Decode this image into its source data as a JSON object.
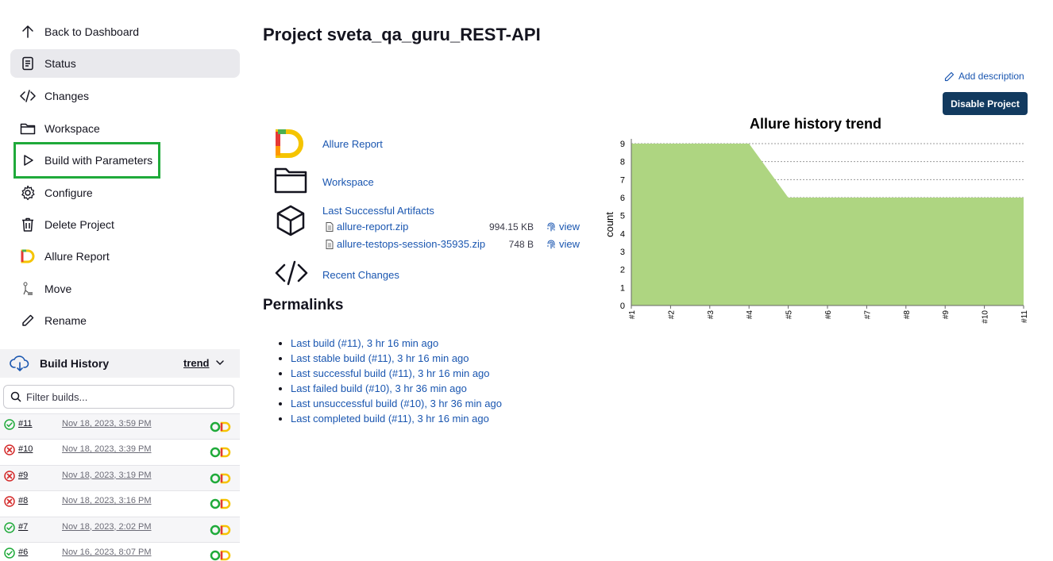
{
  "sidebar": {
    "items": [
      {
        "label": "Back to Dashboard",
        "icon": "arrow-up-icon"
      },
      {
        "label": "Status",
        "icon": "document-icon"
      },
      {
        "label": "Changes",
        "icon": "code-icon"
      },
      {
        "label": "Workspace",
        "icon": "folder-icon"
      },
      {
        "label": "Build with Parameters",
        "icon": "play-icon"
      },
      {
        "label": "Configure",
        "icon": "gear-icon"
      },
      {
        "label": "Delete Project",
        "icon": "trash-icon"
      },
      {
        "label": "Allure Report",
        "icon": "allure-icon"
      },
      {
        "label": "Move",
        "icon": "move-icon"
      },
      {
        "label": "Rename",
        "icon": "pencil-icon"
      }
    ],
    "active": "Status"
  },
  "build_history": {
    "title": "Build History",
    "trend_label": "trend",
    "filter_placeholder": "Filter builds...",
    "builds": [
      {
        "number": "#11",
        "date": "Nov 18, 2023, 3:59 PM",
        "status": "success"
      },
      {
        "number": "#10",
        "date": "Nov 18, 2023, 3:39 PM",
        "status": "failed"
      },
      {
        "number": "#9",
        "date": "Nov 18, 2023, 3:19 PM",
        "status": "failed"
      },
      {
        "number": "#8",
        "date": "Nov 18, 2023, 3:16 PM",
        "status": "failed"
      },
      {
        "number": "#7",
        "date": "Nov 18, 2023, 2:02 PM",
        "status": "success"
      },
      {
        "number": "#6",
        "date": "Nov 16, 2023, 8:07 PM",
        "status": "success"
      }
    ]
  },
  "main": {
    "title": "Project sveta_qa_guru_REST-API",
    "add_description": "Add description",
    "disable_button": "Disable Project",
    "links": {
      "allure_report": "Allure Report",
      "workspace": "Workspace",
      "last_artifacts": "Last Successful Artifacts",
      "recent_changes": "Recent Changes"
    },
    "artifacts": [
      {
        "name": "allure-report.zip",
        "size": "994.15 KB",
        "view": "view"
      },
      {
        "name": "allure-testops-session-35935.zip",
        "size": "748 B",
        "view": "view"
      }
    ],
    "permalinks_title": "Permalinks",
    "permalinks": [
      "Last build (#11), 3 hr 16 min ago",
      "Last stable build (#11), 3 hr 16 min ago",
      "Last successful build (#11), 3 hr 16 min ago",
      "Last failed build (#10), 3 hr 36 min ago",
      "Last unsuccessful build (#10), 3 hr 36 min ago",
      "Last completed build (#11), 3 hr 16 min ago"
    ]
  },
  "colors": {
    "success": "#1faa3a",
    "failed": "#d42a2a",
    "link": "#1a56b0",
    "button": "#123a5f",
    "chart_fill": "#aed581"
  },
  "chart_data": {
    "type": "area",
    "title": "Allure history trend",
    "xlabel": "",
    "ylabel": "count",
    "categories": [
      "#1",
      "#2",
      "#3",
      "#4",
      "#5",
      "#6",
      "#7",
      "#8",
      "#9",
      "#10",
      "#11"
    ],
    "series": [
      {
        "values": [
          9,
          9,
          9,
          9,
          6,
          6,
          6,
          6,
          6,
          6,
          6
        ]
      }
    ],
    "ylim": [
      0,
      9
    ],
    "yticks": [
      0,
      1,
      2,
      3,
      4,
      5,
      6,
      7,
      8,
      9
    ],
    "grid": true
  }
}
